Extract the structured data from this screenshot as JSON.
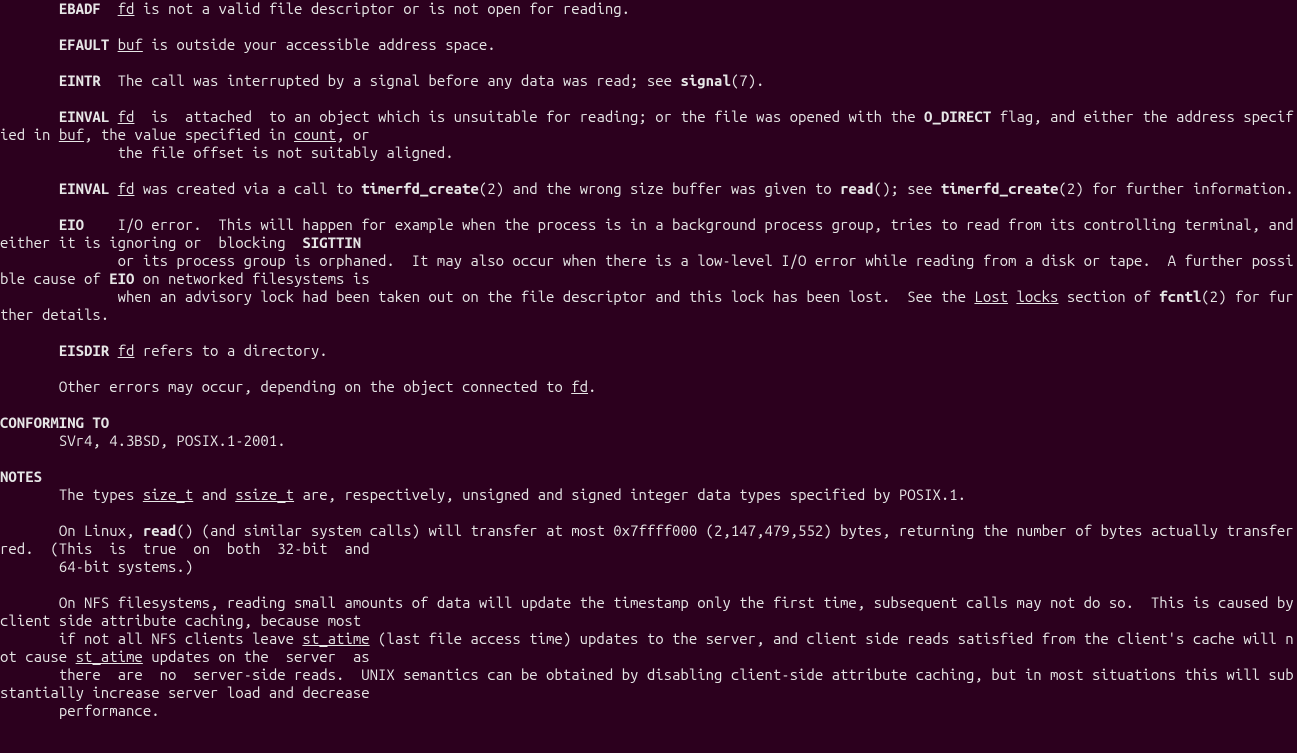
{
  "errors": {
    "ebadf": {
      "tag": "EBADF",
      "arg": "fd",
      "text": " is not a valid file descriptor or is not open for reading."
    },
    "efault": {
      "tag": "EFAULT",
      "arg": "buf",
      "text": " is outside your accessible address space."
    },
    "eintr": {
      "tag": "EINTR",
      "text1": "  The call was interrupted by a signal before any data was read; see ",
      "sig": "signal",
      "text2": "(7)."
    },
    "einval1": {
      "tag": "EINVAL",
      "arg": "fd",
      "t1": "  is  attached  to an object which is unsuitable for reading; or the file was opened with the ",
      "flag": "O_DIRECT",
      "t2": " flag, and either the address specified in ",
      "buf": "buf",
      "t3": ", the value specified in ",
      "count": "count",
      "t4": ", or",
      "line2": "              the file offset is not suitably aligned."
    },
    "einval2": {
      "tag": "EINVAL",
      "arg": "fd",
      "t1": " was created via a call to ",
      "tfd": "timerfd_create",
      "t2": "(2) and the wrong size buffer was given to ",
      "read": "read",
      "t3": "(); see ",
      "tfd2": "timerfd_create",
      "t4": "(2) for further information."
    },
    "eio": {
      "tag": "EIO",
      "t1": "    I/O error.  This will happen for example when the process is in a background process group, tries to read from its controlling terminal, and either it is ignoring or  blocking  ",
      "sig": "SIGTTIN",
      "line2a": "              or its process group is orphaned.  It may also occur when there is a low-level I/O error while reading from a disk or tape.  A further possible cause of ",
      "eio2": "EIO",
      "line2b": " on networked filesystems is",
      "line3a": "              when an advisory lock had been taken out on the file descriptor and this lock has been lost.  See the ",
      "lost": "Lost",
      "sp": " ",
      "locks": "locks",
      "line3b": " section of ",
      "fcntl": "fcntl",
      "line3c": "(2) for further details."
    },
    "eisdir": {
      "tag": "EISDIR",
      "arg": "fd",
      "text": " refers to a directory."
    },
    "other": {
      "t1": "       Other errors may occur, depending on the object connected to ",
      "fd": "fd",
      "t2": "."
    }
  },
  "conforming": {
    "heading": "CONFORMING TO",
    "text": "       SVr4, 4.3BSD, POSIX.1-2001."
  },
  "notes": {
    "heading": "NOTES",
    "p1": {
      "t1": "       The types ",
      "size_t": "size_t",
      "t2": " and ",
      "ssize_t": "ssize_t",
      "t3": " are, respectively, unsigned and signed integer data types specified by POSIX.1."
    },
    "p2": {
      "t1": "       On Linux, ",
      "read": "read",
      "t2": "() (and similar system calls) will transfer at most 0x7ffff000 (2,147,479,552) bytes, returning the number of bytes actually transferred.  (This  is  true  on  both  32-bit  and",
      "line2": "       64-bit systems.)"
    },
    "p3": {
      "l1": "       On NFS filesystems, reading small amounts of data will update the timestamp only the first time, subsequent calls may not do so.  This is caused by client side attribute caching, because most",
      "l2a": "       if not all NFS clients leave ",
      "st1": "st_atime",
      "l2b": " (last file access time) updates to the server, and client side reads satisfied from the client's cache will not cause ",
      "st2": "st_atime",
      "l2c": " updates on the  server  as",
      "l3": "       there  are  no  server-side reads.  UNIX semantics can be obtained by disabling client-side attribute caching, but in most situations this will substantially increase server load and decrease",
      "l4": "       performance."
    }
  }
}
